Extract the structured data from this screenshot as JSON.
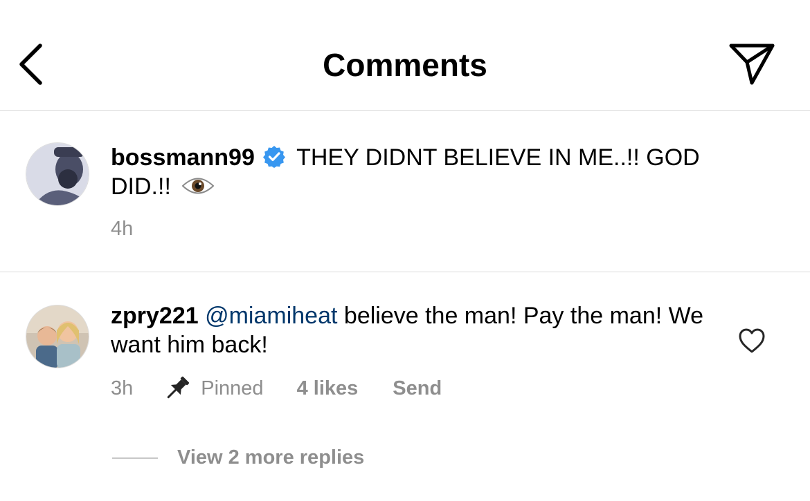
{
  "header": {
    "title": "Comments",
    "back_icon": "chevron-left-icon",
    "share_icon": "paper-plane-icon"
  },
  "caption": {
    "username": "bossmann99",
    "verified": true,
    "text": "THEY DIDNT BELIEVE IN ME..!! GOD DID.!!",
    "emoji": "eye-emoji",
    "time": "4h"
  },
  "comment": {
    "username": "zpry221",
    "mention": "@miamiheat",
    "text": "believe the man! Pay the man! We want him back!",
    "time": "3h",
    "pinned_label": "Pinned",
    "likes_label": "4 likes",
    "send_label": "Send",
    "heart_icon": "heart-outline-icon"
  },
  "replies": {
    "label": "View 2 more replies"
  },
  "colors": {
    "verified_blue": "#3897f0",
    "mention_blue": "#00376b",
    "muted_gray": "#8e8e8e",
    "divider": "#dbdbdb"
  }
}
